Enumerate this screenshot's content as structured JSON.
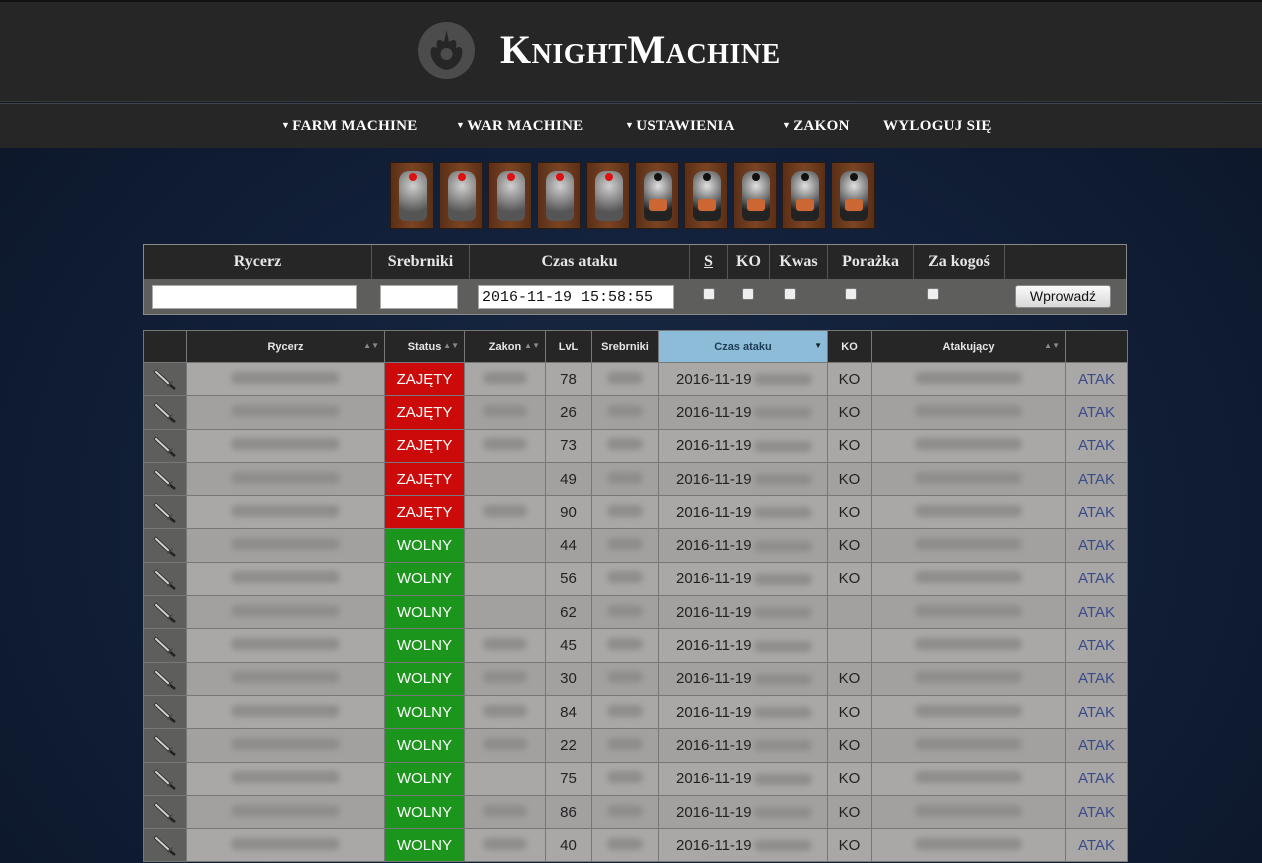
{
  "header": {
    "brand": "KnightMachine",
    "logo_icon": "rebel-alliance-icon"
  },
  "nav": [
    {
      "label": "FARM MACHINE",
      "dropdown": true
    },
    {
      "label": "WAR MACHINE",
      "dropdown": true
    },
    {
      "label": "USTAWIENIA",
      "dropdown": true
    },
    {
      "label": "ZAKON",
      "dropdown": true
    },
    {
      "label": "WYLOGUJ SIĘ",
      "dropdown": false
    }
  ],
  "form": {
    "headers": [
      "Rycerz",
      "Srebrniki",
      "Czas ataku",
      "S",
      "KO",
      "Kwas",
      "Porażka",
      "Za kogoś"
    ],
    "rycerz_value": "",
    "srebrniki_value": "",
    "czas_value": "2016-11-19 15:58:55",
    "submit_label": "Wprowadź"
  },
  "table": {
    "headers": [
      "",
      "Rycerz",
      "Status",
      "Zakon",
      "LvL",
      "Srebrniki",
      "Czas ataku",
      "KO",
      "Atakujący",
      ""
    ],
    "sorted_column": "Czas ataku",
    "action_label": "ATAK",
    "rows": [
      {
        "status": "ZAJĘTY",
        "lvl": "78",
        "date": "2016-11-19",
        "ko": "KO",
        "zakon_blur": true
      },
      {
        "status": "ZAJĘTY",
        "lvl": "26",
        "date": "2016-11-19",
        "ko": "KO",
        "zakon_blur": true
      },
      {
        "status": "ZAJĘTY",
        "lvl": "73",
        "date": "2016-11-19",
        "ko": "KO",
        "zakon_blur": true
      },
      {
        "status": "ZAJĘTY",
        "lvl": "49",
        "date": "2016-11-19",
        "ko": "KO",
        "zakon_blur": false
      },
      {
        "status": "ZAJĘTY",
        "lvl": "90",
        "date": "2016-11-19",
        "ko": "KO",
        "zakon_blur": true
      },
      {
        "status": "WOLNY",
        "lvl": "44",
        "date": "2016-11-19",
        "ko": "KO",
        "zakon_blur": false
      },
      {
        "status": "WOLNY",
        "lvl": "56",
        "date": "2016-11-19",
        "ko": "KO",
        "zakon_blur": false
      },
      {
        "status": "WOLNY",
        "lvl": "62",
        "date": "2016-11-19",
        "ko": "",
        "zakon_blur": false
      },
      {
        "status": "WOLNY",
        "lvl": "45",
        "date": "2016-11-19",
        "ko": "",
        "zakon_blur": true
      },
      {
        "status": "WOLNY",
        "lvl": "30",
        "date": "2016-11-19",
        "ko": "KO",
        "zakon_blur": true
      },
      {
        "status": "WOLNY",
        "lvl": "84",
        "date": "2016-11-19",
        "ko": "KO",
        "zakon_blur": true
      },
      {
        "status": "WOLNY",
        "lvl": "22",
        "date": "2016-11-19",
        "ko": "KO",
        "zakon_blur": true
      },
      {
        "status": "WOLNY",
        "lvl": "75",
        "date": "2016-11-19",
        "ko": "KO",
        "zakon_blur": false
      },
      {
        "status": "WOLNY",
        "lvl": "86",
        "date": "2016-11-19",
        "ko": "KO",
        "zakon_blur": true
      },
      {
        "status": "WOLNY",
        "lvl": "40",
        "date": "2016-11-19",
        "ko": "KO",
        "zakon_blur": true
      }
    ]
  },
  "colors": {
    "busy": "#cc0a0a",
    "free": "#1b951c",
    "header_bg": "#262626",
    "sorted_header": "#8cbcd8",
    "action": "#3a4a8a"
  },
  "avatars": {
    "red_eye_count": 5,
    "dark_count": 5
  }
}
